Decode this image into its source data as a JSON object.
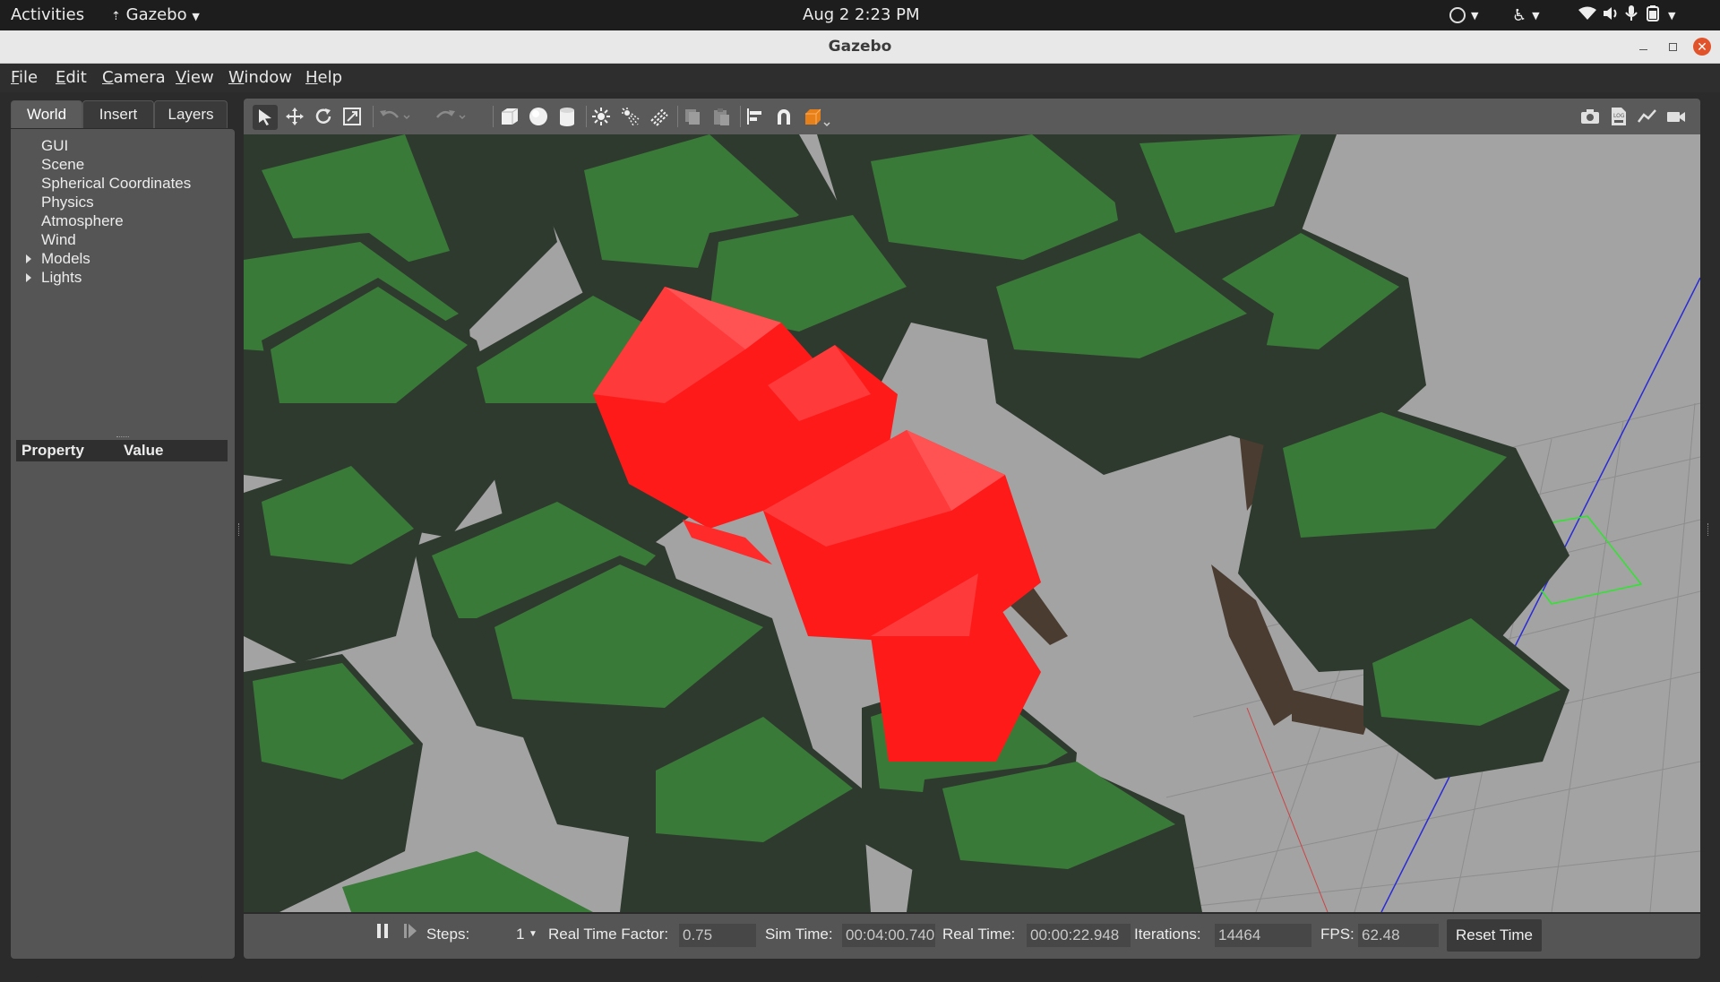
{
  "topbar": {
    "activities": "Activities",
    "app_name": "Gazebo",
    "clock": "Aug 2  2:23 PM"
  },
  "window": {
    "title": "Gazebo"
  },
  "menu": {
    "items": [
      "File",
      "Edit",
      "Camera",
      "View",
      "Window",
      "Help"
    ]
  },
  "left_panel": {
    "tabs": [
      "World",
      "Insert",
      "Layers"
    ],
    "active_tab": "World",
    "tree": [
      {
        "label": "GUI",
        "expandable": false
      },
      {
        "label": "Scene",
        "expandable": false
      },
      {
        "label": "Spherical Coordinates",
        "expandable": false
      },
      {
        "label": "Physics",
        "expandable": false
      },
      {
        "label": "Atmosphere",
        "expandable": false
      },
      {
        "label": "Wind",
        "expandable": false
      },
      {
        "label": "Models",
        "expandable": true
      },
      {
        "label": "Lights",
        "expandable": true
      }
    ],
    "property_header": {
      "property": "Property",
      "value": "Value"
    }
  },
  "toolbar": {
    "left_icons": [
      "select-arrow-icon",
      "translate-icon",
      "rotate-icon",
      "scale-icon",
      "undo-icon",
      "redo-icon",
      "box-icon",
      "sphere-icon",
      "cylinder-icon",
      "point-light-icon",
      "spot-light-icon",
      "directional-light-icon",
      "copy-icon",
      "paste-icon",
      "align-icon",
      "snap-icon",
      "view-angle-icon"
    ],
    "right_icons": [
      "screenshot-icon",
      "log-icon",
      "plot-icon",
      "record-video-icon"
    ]
  },
  "scene": {
    "colors": {
      "foliage_light": "#3c7a3a",
      "foliage_dark": "#2f3a2f",
      "selected": "#ff2a2a",
      "ground": "#a3a3a3",
      "grid": "#8c8c8c",
      "trunk": "#4a3c30"
    }
  },
  "bottombar": {
    "steps_label": "Steps:",
    "steps_value": "1",
    "rtf_label": "Real Time Factor:",
    "rtf_value": "0.75",
    "sim_time_label": "Sim Time:",
    "sim_time_value": "00:04:00.740",
    "real_time_label": "Real Time:",
    "real_time_value": "00:00:22.948",
    "iterations_label": "Iterations:",
    "iterations_value": "14464",
    "fps_label": "FPS:",
    "fps_value": "62.48",
    "reset_label": "Reset Time"
  }
}
